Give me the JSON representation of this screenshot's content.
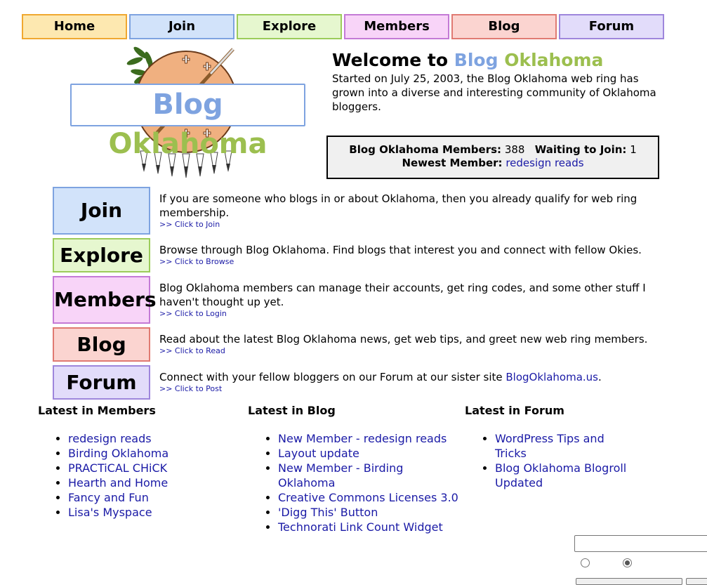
{
  "nav": [
    {
      "label": "Home",
      "bg": "#fde8b0",
      "border": "#f0a830"
    },
    {
      "label": "Join",
      "bg": "#d2e3fa",
      "border": "#7ea3e0"
    },
    {
      "label": "Explore",
      "bg": "#e6f7cf",
      "border": "#9ccc5a"
    },
    {
      "label": "Members",
      "bg": "#f8d4f8",
      "border": "#c47ad6"
    },
    {
      "label": "Blog",
      "bg": "#fbd4d0",
      "border": "#e07a72"
    },
    {
      "label": "Forum",
      "bg": "#e2dcfa",
      "border": "#9e86dc"
    }
  ],
  "logo": {
    "word1": "Blog",
    "word2": "Oklahoma",
    "color1": "#7ea3e0",
    "color2": "#9cbf4f"
  },
  "welcome": {
    "title_prefix": "Welcome to",
    "title_word1": "Blog",
    "title_word2": "Oklahoma",
    "text": "Started on July 25, 2003, the Blog Oklahoma web ring has grown into a diverse and interesting community of Oklahoma bloggers."
  },
  "stats": {
    "members_label": "Blog Oklahoma Members:",
    "members_value": "388",
    "waiting_label": "Waiting to Join:",
    "waiting_value": "1",
    "newest_label": "Newest Member:",
    "newest_value": "redesign reads"
  },
  "features": [
    {
      "button": "Join",
      "text": "If you are someone who blogs in or about Oklahoma, then you already qualify for web ring membership.",
      "link": ">> Click to Join"
    },
    {
      "button": "Explore",
      "text": "Browse through Blog Oklahoma. Find blogs that interest you and connect with fellow Okies.",
      "link": ">> Click to Browse"
    },
    {
      "button": "Members",
      "text": "Blog Oklahoma members can manage their accounts, get ring codes, and some other stuff I haven't thought up yet.",
      "link": ">> Click to Login"
    },
    {
      "button": "Blog",
      "text": "Read about the latest Blog Oklahoma news, get web tips, and greet new web ring members.",
      "link": ">> Click to Read"
    },
    {
      "button": "Forum",
      "text_before": "Connect with your fellow bloggers on our Forum at our sister site ",
      "text_link": "BlogOklahoma.us",
      "text_after": ".",
      "link": ">> Click to Post"
    }
  ],
  "latest_members": {
    "heading": "Latest in Members",
    "items": [
      "redesign reads",
      "Birding Oklahoma",
      "PRACTiCAL CHiCK",
      "Hearth and Home",
      "Fancy and Fun",
      "Lisa's Myspace"
    ]
  },
  "latest_blog": {
    "heading": "Latest in Blog",
    "items": [
      "New Member - redesign reads",
      "Layout update",
      "New Member - Birding Oklahoma",
      "Creative Commons Licenses 3.0",
      "'Digg This' Button",
      "Technorati Link Count Widget"
    ]
  },
  "latest_forum": {
    "heading": "Latest in Forum",
    "items": [
      "WordPress Tips and Tricks",
      "Blog Oklahoma Blogroll Updated"
    ]
  },
  "colors": {
    "link": "#1a1aa6",
    "stats_bg": "#f0f0f0"
  }
}
